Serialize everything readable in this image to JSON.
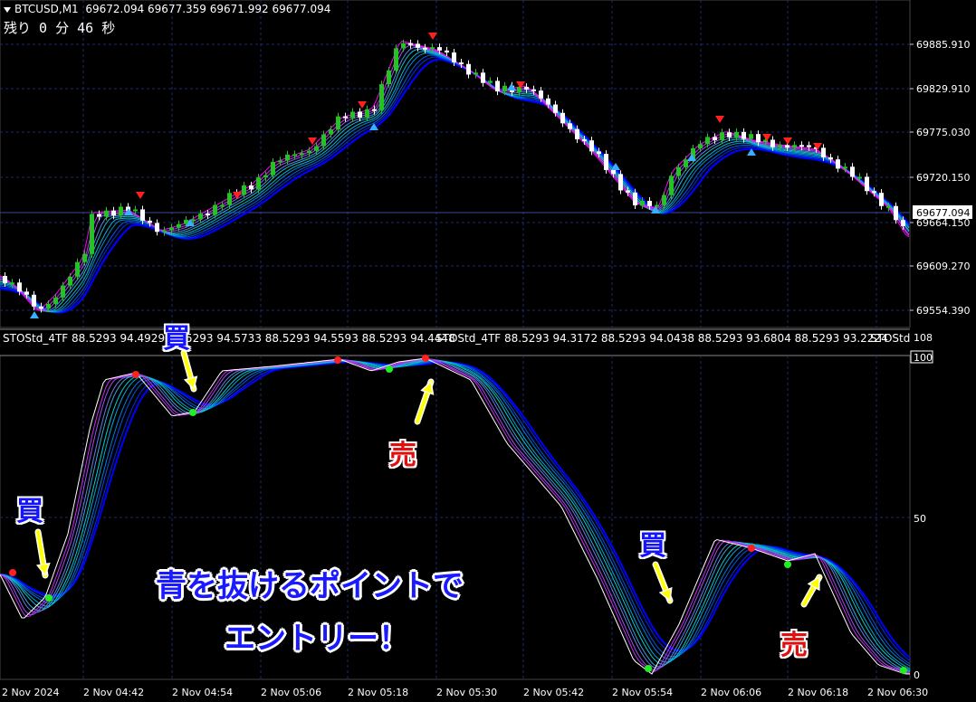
{
  "header": {
    "symbol": "BTCUSD,M1",
    "ohlc": "69672.094 69677.359 69671.992 69677.094",
    "timer": "残り 0 分 46 秒"
  },
  "price_axis": {
    "labels": [
      "69885.910",
      "69829.910",
      "69775.030",
      "69720.150",
      "69664.150",
      "69609.270",
      "69554.390"
    ],
    "current": "69677.094"
  },
  "indicator": {
    "label_1": "STOStd_4TF 88.5293 94.4929 88.5293 94.5733 88.5293 94.5593 88.5293 94.4448",
    "label_2": "STOStd_4TF 88.5293 94.3172 88.5293 94.0438 88.5293 93.6804 88.5293 93.2224",
    "label_3": "STOStd",
    "axis": [
      "108",
      "100",
      "50",
      "0"
    ]
  },
  "time_axis": [
    "2 Nov 2024",
    "2 Nov 04:42",
    "2 Nov 04:54",
    "2 Nov 05:06",
    "2 Nov 05:18",
    "2 Nov 05:30",
    "2 Nov 05:42",
    "2 Nov 05:54",
    "2 Nov 06:06",
    "2 Nov 06:18",
    "2 Nov 06:30"
  ],
  "annotations": {
    "buy": "買",
    "sell": "売",
    "caption_line1": "青を抜けるポイントで",
    "caption_line2": "エントリー！"
  },
  "colors": {
    "background": "#000000",
    "grid": "#1c2a6e",
    "up_candle": "#22c322",
    "down_candle": "#ffffff",
    "ribbon_fast": "#ff00ff",
    "ribbon_slow": "#0000ff",
    "ribbon_mid": "#00ced1",
    "arrow": "#ffff00"
  }
}
